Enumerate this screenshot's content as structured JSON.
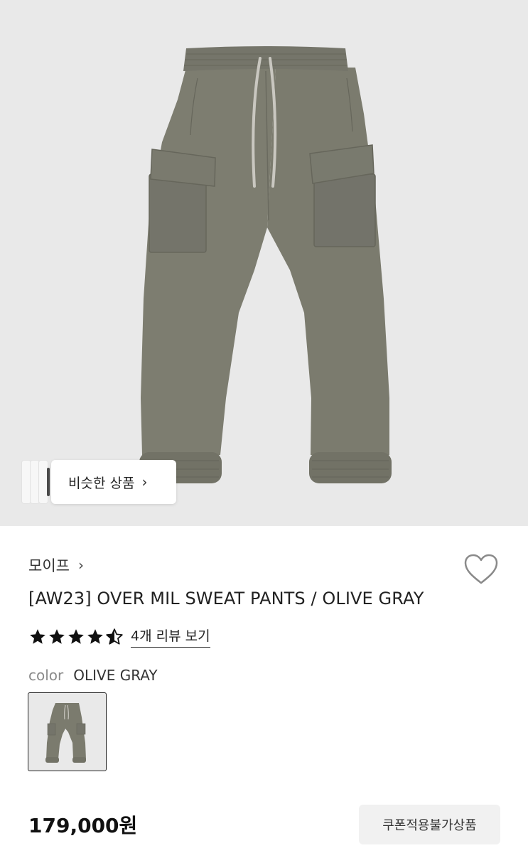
{
  "similar_products": {
    "label": "비슷한 상품"
  },
  "brand": {
    "name": "모이프"
  },
  "product": {
    "title": "[AW23] OVER MIL SWEAT PANTS / OLIVE GRAY",
    "rating": 4.5,
    "rating_max": 5,
    "review_link": "4개 리뷰 보기"
  },
  "color": {
    "label": "color",
    "value": "OLIVE GRAY"
  },
  "price": {
    "amount": "179,000원"
  },
  "coupon": {
    "label": "쿠폰적용불가상품"
  },
  "colors": {
    "hero_bg": "#e9e9e9",
    "pants": "#7b7b6e",
    "accent": "#111111"
  },
  "icons": {
    "heart": "heart-icon",
    "chevron": "chevron-right-icon",
    "star": "star-icon"
  }
}
